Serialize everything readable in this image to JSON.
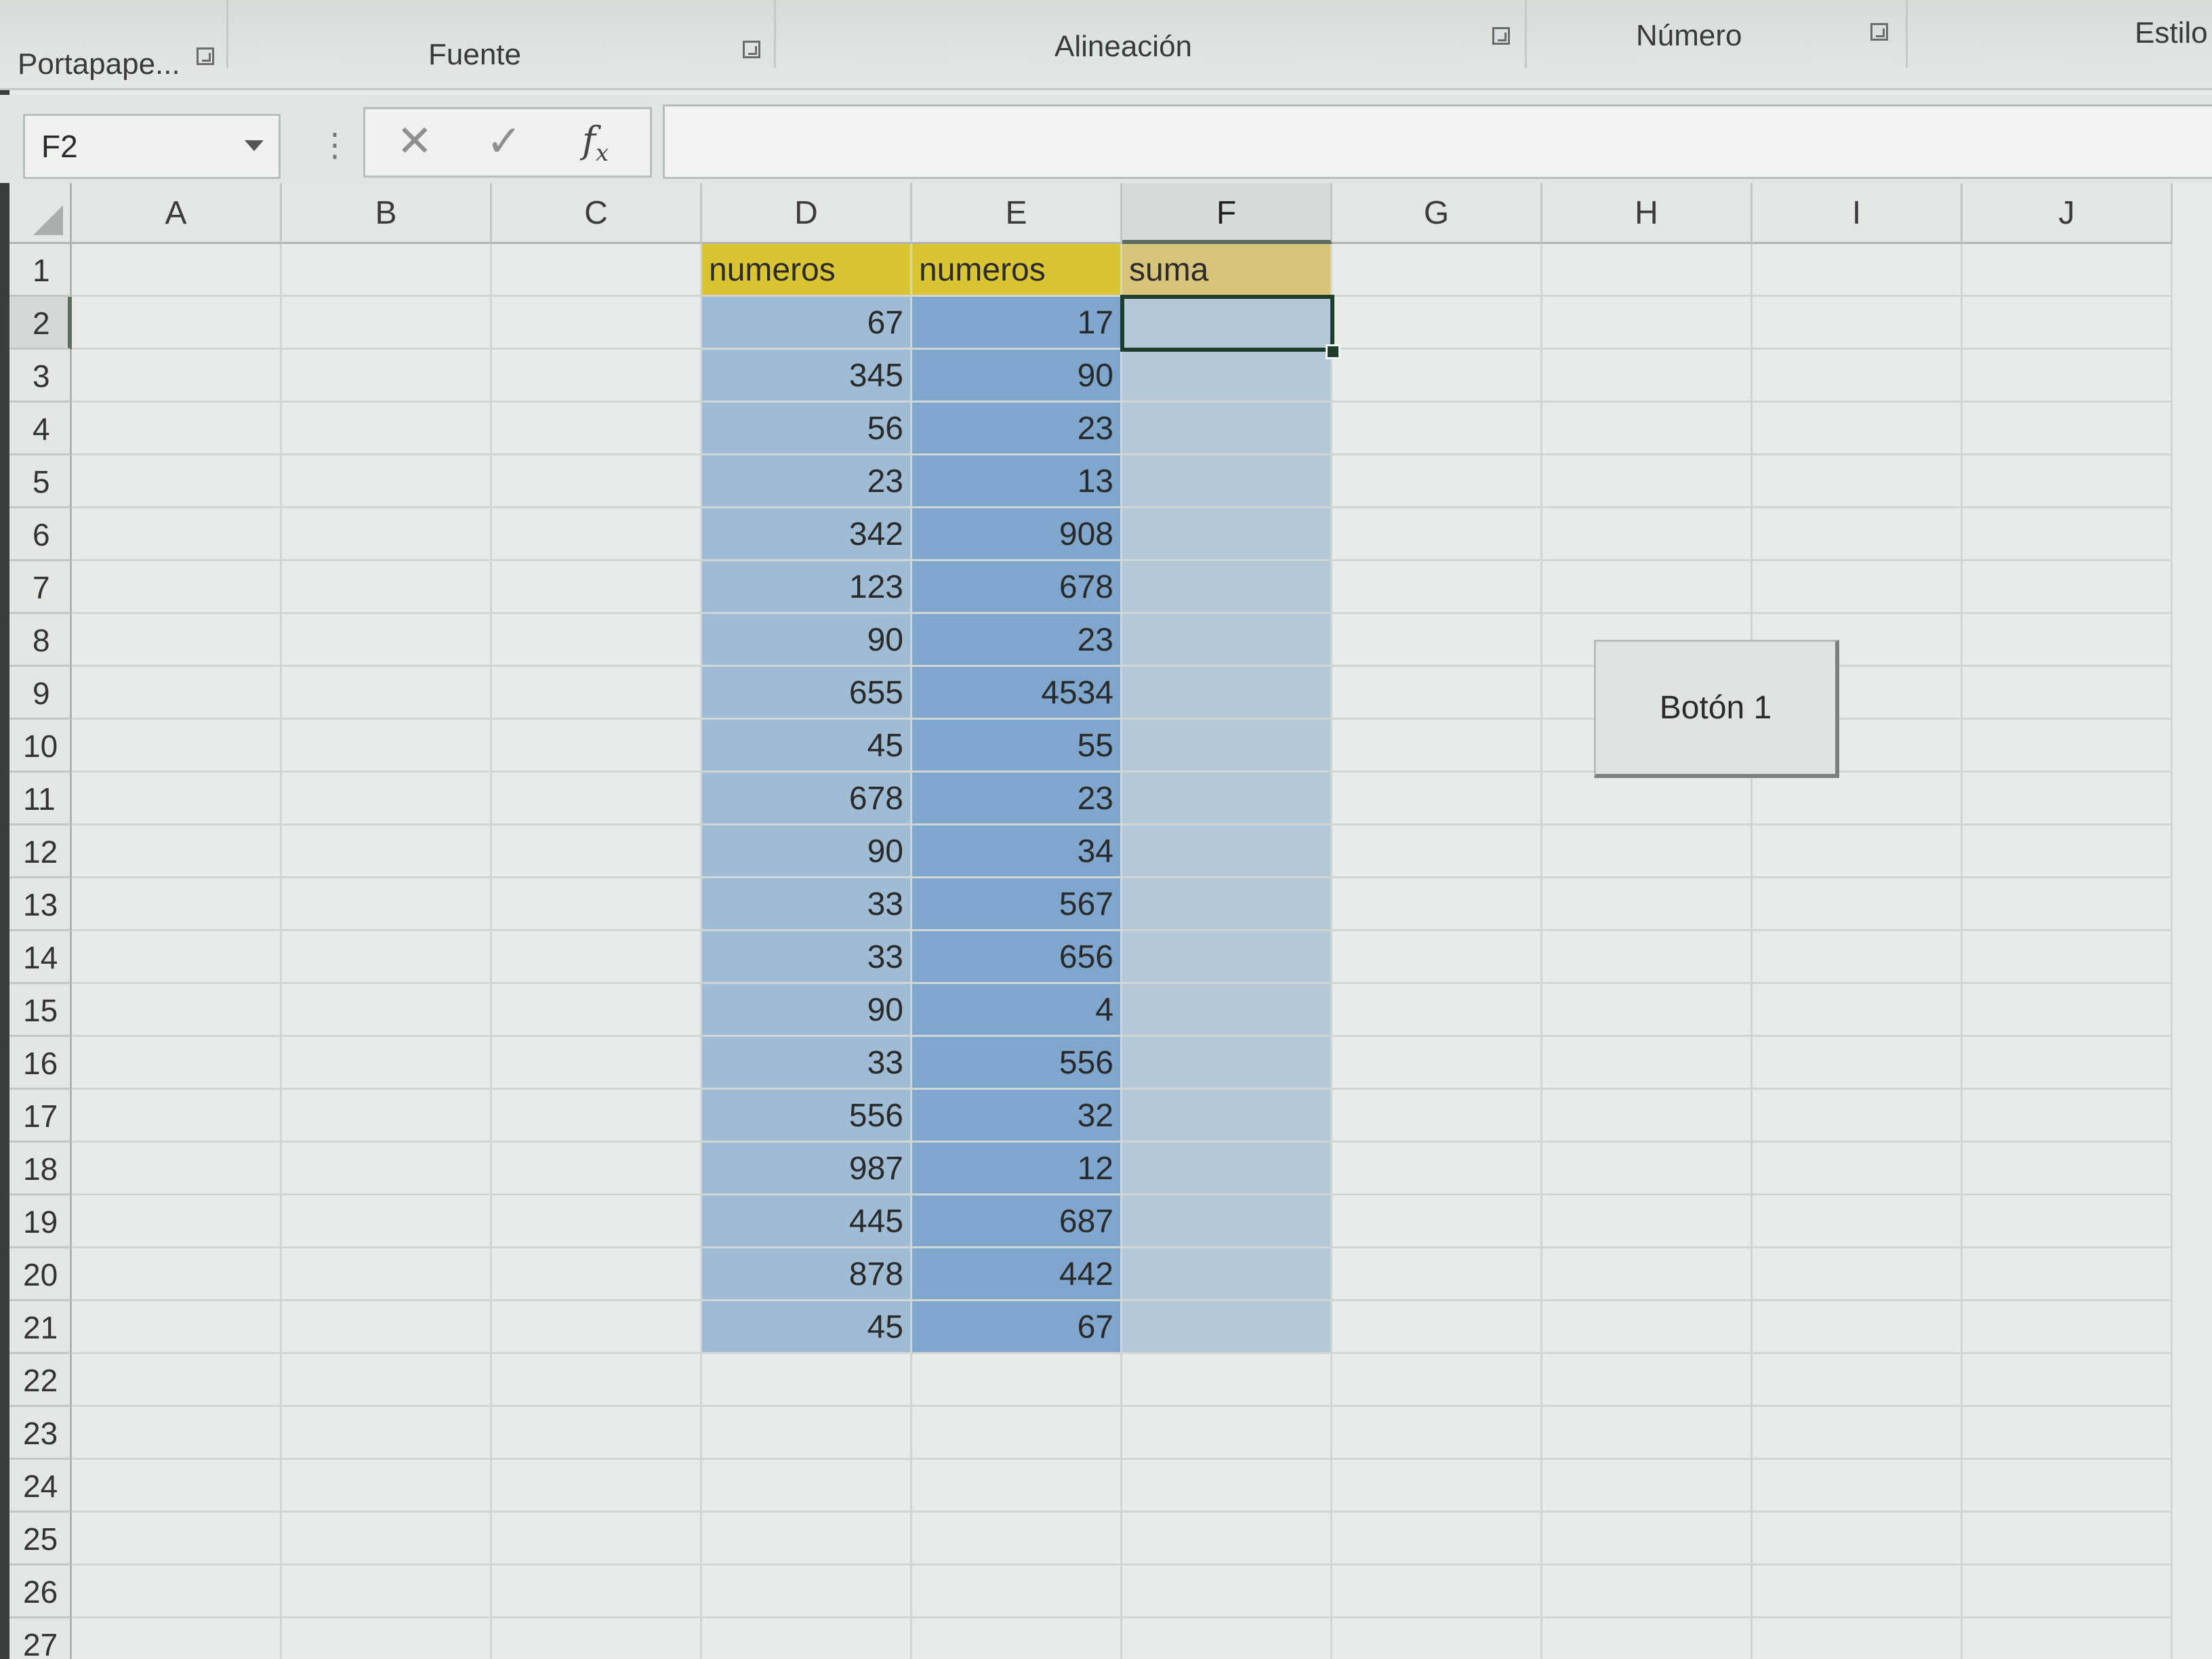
{
  "ribbon": {
    "groups": [
      "Portapape...",
      "Fuente",
      "Alineación",
      "Número",
      "Estilo"
    ]
  },
  "formula_bar": {
    "name_box": "F2",
    "cancel_icon": "close-icon",
    "enter_icon": "check-icon",
    "fx_label": "fx",
    "content": ""
  },
  "sheet": {
    "columns": [
      "A",
      "B",
      "C",
      "D",
      "E",
      "F",
      "G",
      "H",
      "I",
      "J"
    ],
    "rows": [
      "1",
      "2",
      "3",
      "4",
      "5",
      "6",
      "7",
      "8",
      "9",
      "10",
      "11",
      "12",
      "13",
      "14",
      "15",
      "16",
      "17",
      "18",
      "19",
      "20",
      "21",
      "22",
      "23",
      "24",
      "25",
      "26",
      "27"
    ],
    "selected_cell": "F2",
    "headers": {
      "D": "numeros",
      "E": "numeros",
      "F": "suma"
    },
    "column_D": [
      67,
      345,
      56,
      23,
      342,
      123,
      90,
      655,
      45,
      678,
      90,
      33,
      33,
      90,
      33,
      556,
      987,
      445,
      878,
      45
    ],
    "column_E": [
      17,
      90,
      23,
      13,
      908,
      678,
      23,
      4534,
      55,
      23,
      34,
      567,
      656,
      4,
      556,
      32,
      12,
      687,
      442,
      67
    ],
    "header_colors": {
      "numeros": "#d9c533",
      "suma": "#d8c37a"
    },
    "fill_colors": {
      "D": "#9fbcd4",
      "E": "#7fa6cc",
      "F": "#b4c8d8"
    }
  },
  "form_button": {
    "label": "Botón 1"
  }
}
